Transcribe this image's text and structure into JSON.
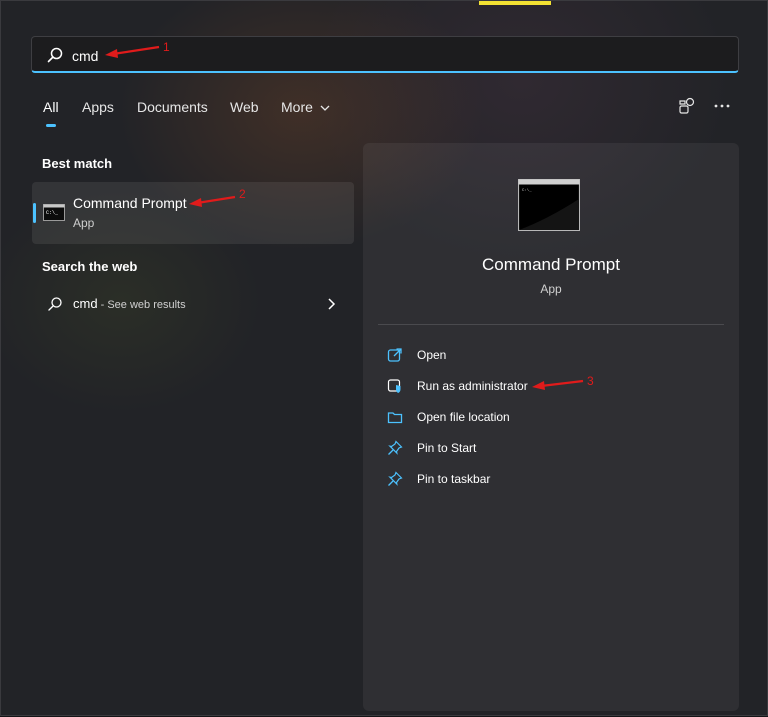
{
  "search": {
    "value": "cmd",
    "placeholder": ""
  },
  "tabs": [
    {
      "label": "All",
      "active": true
    },
    {
      "label": "Apps"
    },
    {
      "label": "Documents"
    },
    {
      "label": "Web"
    },
    {
      "label": "More"
    }
  ],
  "top_icons": [
    "share-feedback-icon",
    "more-options-icon"
  ],
  "best_match": {
    "heading": "Best match",
    "name": "Command Prompt",
    "type": "App",
    "icon": "command-prompt-icon"
  },
  "web": {
    "heading": "Search the web",
    "query": "cmd",
    "hint": " - See web results"
  },
  "detail": {
    "title": "Command Prompt",
    "subtitle": "App",
    "actions": [
      {
        "label": "Open",
        "icon": "open-icon"
      },
      {
        "label": "Run as administrator",
        "icon": "shield-icon"
      },
      {
        "label": "Open file location",
        "icon": "folder-icon"
      },
      {
        "label": "Pin to Start",
        "icon": "pin-icon"
      },
      {
        "label": "Pin to taskbar",
        "icon": "pin-icon"
      }
    ]
  },
  "annotations": {
    "n1": "1",
    "n2": "2",
    "n3": "3"
  },
  "colors": {
    "accent": "#4cc2ff",
    "annotation": "#e01b1b",
    "background": "#222327"
  }
}
